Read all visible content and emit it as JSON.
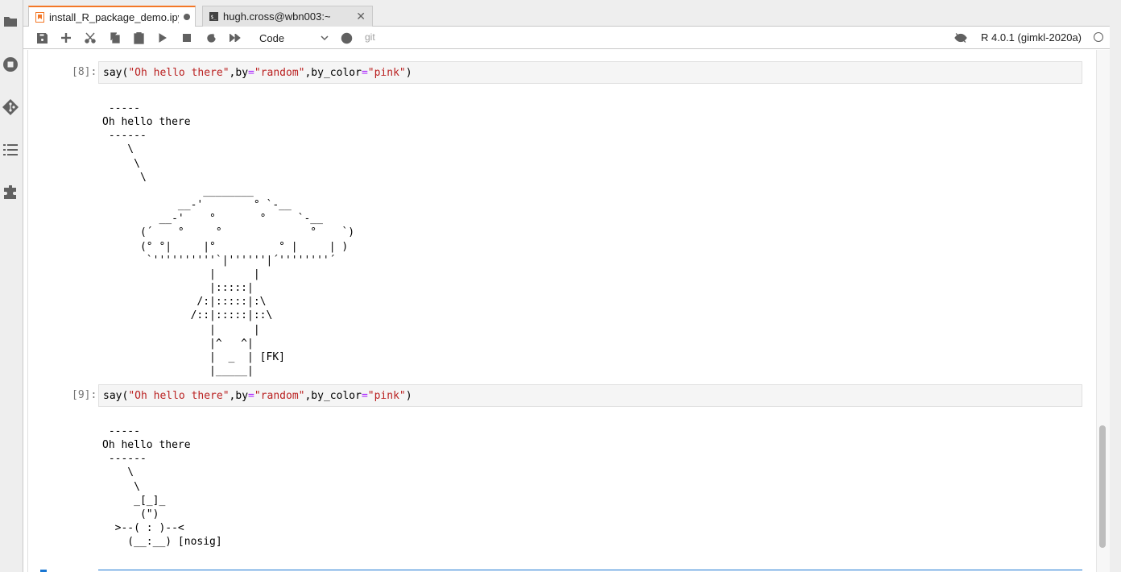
{
  "tabs": [
    {
      "label": "install_R_package_demo.ipynb",
      "active": true,
      "modified": true,
      "icon": "notebook-icon"
    },
    {
      "label": "hugh.cross@wbn003:~",
      "active": false,
      "modified": false,
      "icon": "terminal-icon"
    }
  ],
  "sidebar": {
    "icons": [
      "folder-icon",
      "running-icon",
      "git-icon",
      "toc-icon",
      "extension-icon"
    ]
  },
  "toolbar": {
    "cell_type": "Code",
    "git_label": "git",
    "kernel_name": "R 4.0.1 (gimkl-2020a)"
  },
  "cells": [
    {
      "prompt": "[8]:",
      "code": {
        "fn": "say(",
        "s1": "\"Oh hello there\"",
        "c1": ",by",
        "eq1": "=",
        "s2": "\"random\"",
        "c2": ",by_color",
        "eq2": "=",
        "s3": "\"pink\"",
        "end": ")"
      },
      "output": " -----\nOh hello there\n ------\n    \\\n     \\\n      \\\n                ________\n            __-'        ° `-__\n         __-'    °       °     `-__\n      (´    °     °              °    `)\n      (° °|     |°          ° |     | )\n       `''''''''''`|''''''|´''''''''´\n                 |      |\n                 |:::::|\n               /:|:::::|:\\\n              /::|:::::|::\\\n                 |      |\n                 |^   ^|\n                 |  _  | [FK]\n                 |_____|"
    },
    {
      "prompt": "[9]:",
      "code": {
        "fn": "say(",
        "s1": "\"Oh hello there\"",
        "c1": ",by",
        "eq1": "=",
        "s2": "\"random\"",
        "c2": ",by_color",
        "eq2": "=",
        "s3": "\"pink\"",
        "end": ")"
      },
      "output": " -----\nOh hello there\n ------\n    \\\n     \\\n     _[_]_\n      (\")\n  >--( : )--<\n    (__:__) [nosig]"
    }
  ],
  "colors": {
    "accent": "#f37726",
    "selection": "#1976d2",
    "string": "#ba2121",
    "operator": "#aa22ff"
  }
}
